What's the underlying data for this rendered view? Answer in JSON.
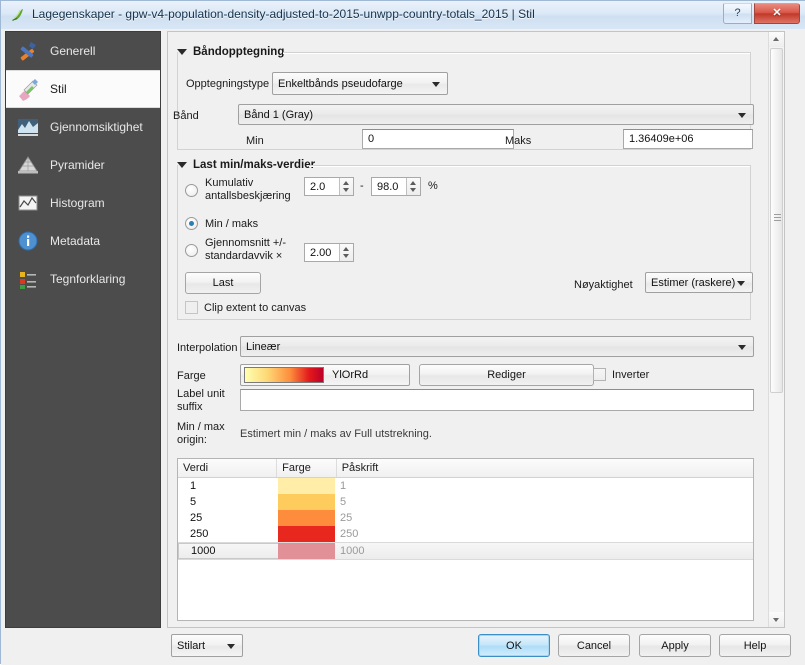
{
  "window": {
    "title": "Lagegenskaper - gpw-v4-population-density-adjusted-to-2015-unwpp-country-totals_2015 | Stil",
    "help_button": "?",
    "close_button": "✕"
  },
  "sidebar": {
    "items": [
      {
        "label": "Generell",
        "icon": "tools-icon",
        "selected": false
      },
      {
        "label": "Stil",
        "icon": "brush-icon",
        "selected": true
      },
      {
        "label": "Gjennomsiktighet",
        "icon": "transparency-icon",
        "selected": false
      },
      {
        "label": "Pyramider",
        "icon": "pyramid-icon",
        "selected": false
      },
      {
        "label": "Histogram",
        "icon": "histogram-icon",
        "selected": false
      },
      {
        "label": "Metadata",
        "icon": "info-icon",
        "selected": false
      },
      {
        "label": "Tegnforklaring",
        "icon": "legend-icon",
        "selected": false
      }
    ]
  },
  "band_rendering": {
    "title": "Båndopptegning",
    "render_type_label": "Opptegningstype",
    "render_type_value": "Enkeltbånds pseudofarge",
    "band_label": "Bånd",
    "band_value": "Bånd 1 (Gray)",
    "min_label": "Min",
    "min_value": "0",
    "max_label": "Maks",
    "max_value": "1.36409e+06"
  },
  "load_minmax": {
    "title": "Last min/maks-verdier",
    "cumulative_label": "Kumulativ\nantallsbeskjæring",
    "cumulative_selected": false,
    "cumulative_lower": "2.0",
    "cumulative_dash": "-",
    "cumulative_upper": "98.0",
    "cumulative_unit": "%",
    "minmax_label": "Min / maks",
    "minmax_selected": true,
    "stddev_label": "Gjennomsnitt +/-\nstandardavvik ×",
    "stddev_selected": false,
    "stddev_value": "2.00",
    "load_button": "Last",
    "accuracy_label": "Nøyaktighet",
    "accuracy_value": "Estimer (raskere)",
    "clip_label": "Clip extent to canvas",
    "clip_checked": false
  },
  "style_options": {
    "interpolation_label": "Interpolation",
    "interpolation_value": "Lineær",
    "color_label": "Farge",
    "color_ramp_name": "YlOrRd",
    "edit_button": "Rediger",
    "invert_label": "Inverter",
    "invert_checked": false,
    "label_unit_suffix_label": "Label unit\nsuffix",
    "label_unit_suffix_value": "",
    "minmax_origin_label": "Min / max\norigin:",
    "minmax_origin_value": "Estimert min / maks av Full utstrekning."
  },
  "class_table": {
    "columns": [
      "Verdi",
      "Farge",
      "Påskrift"
    ],
    "rows": [
      {
        "value": "1",
        "color": "#ffeda8",
        "label": "1",
        "selected": false
      },
      {
        "value": "5",
        "color": "#fecc5c",
        "label": "5",
        "selected": false
      },
      {
        "value": "25",
        "color": "#fd8d3c",
        "label": "25",
        "selected": false
      },
      {
        "value": "250",
        "color": "#e8271e",
        "label": "250",
        "selected": false
      },
      {
        "value": "1000",
        "color": "#e09096",
        "label": "1000",
        "selected": true
      }
    ]
  },
  "footer": {
    "style_button": "Stilart",
    "ok_button": "OK",
    "cancel_button": "Cancel",
    "apply_button": "Apply",
    "help_button": "Help"
  },
  "colors": {
    "ramp_start": "#ffffb2",
    "ramp_mid": "#fd8d3c",
    "ramp_end": "#bd0026",
    "accent": "#2a7fb5",
    "sidebar_bg": "#4c4c4c"
  }
}
